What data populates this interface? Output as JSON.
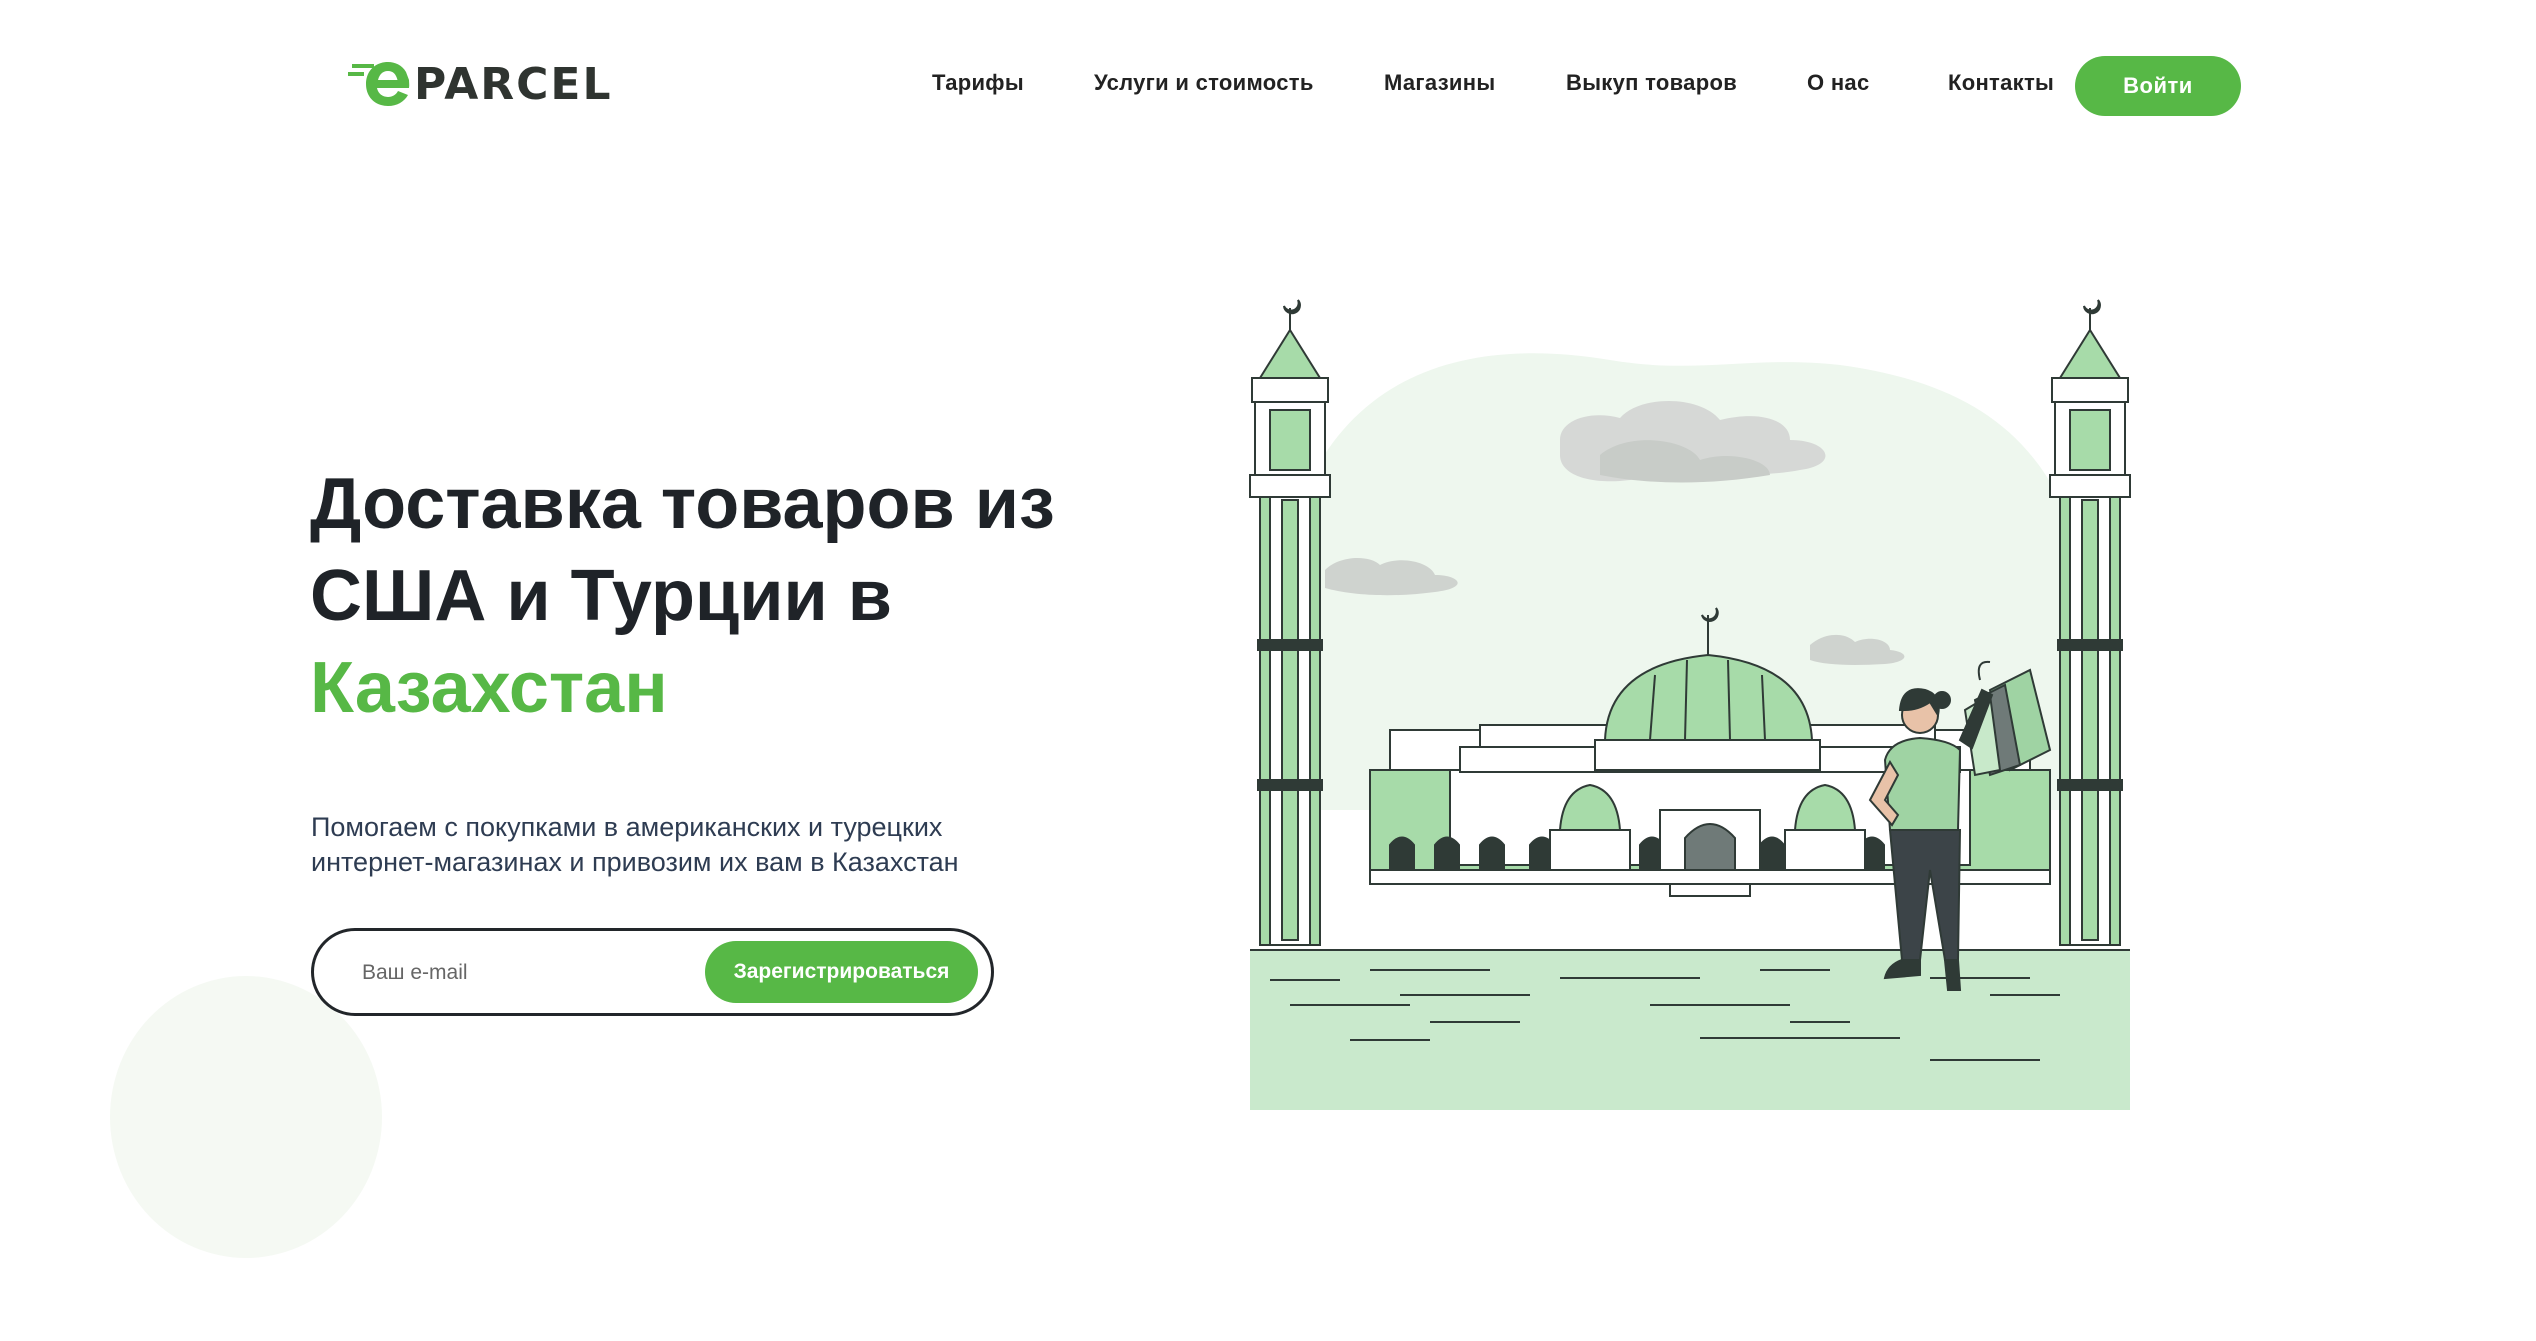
{
  "brand": {
    "logo_text": "PARCEL",
    "logo_icon": "e-letter-logo-icon",
    "accent_color": "#57b846"
  },
  "nav": {
    "items": [
      {
        "label": "Тарифы"
      },
      {
        "label": "Услуги и стоимость"
      },
      {
        "label": "Магазины"
      },
      {
        "label": "Выкуп товаров"
      },
      {
        "label": "О нас"
      },
      {
        "label": "Контакты"
      }
    ],
    "login_label": "Войти"
  },
  "hero": {
    "title_line1": "Доставка товаров из",
    "title_line2": "США и Турции в",
    "title_accent": "Казахстан",
    "subtitle": "Помогаем с покупками в американских и турецких интернет-магазинах и привозим их вам в Казахстан",
    "email_placeholder": "Ваш e-mail",
    "signup_label": "Зарегистрироваться"
  },
  "illustration": {
    "icon": "mosque-shopping-woman-illustration"
  }
}
